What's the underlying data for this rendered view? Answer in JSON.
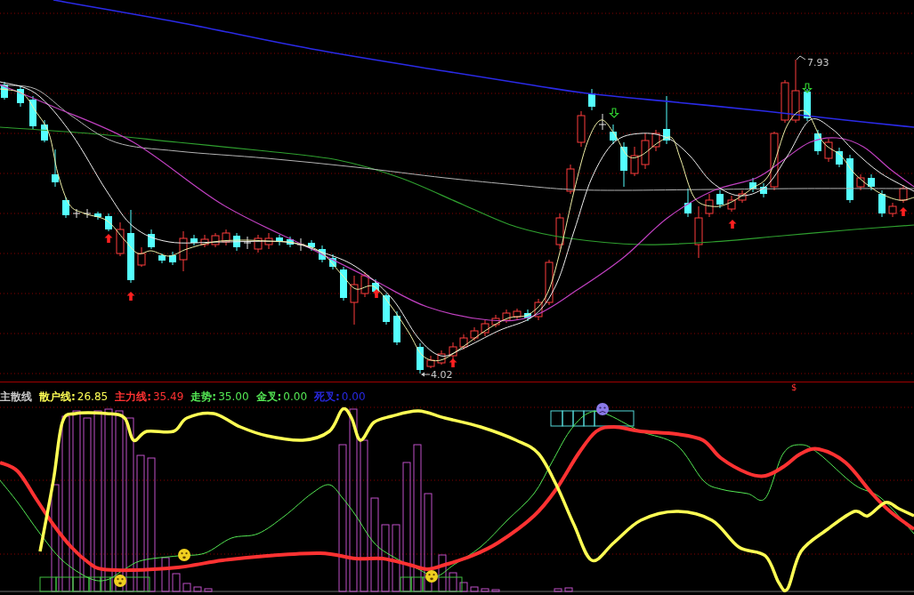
{
  "price_chart": {
    "high_label": "7.93",
    "low_label": "4.02",
    "signal_mark": "$"
  },
  "indicator_legend": [
    {
      "label": "主散线",
      "color": "#c8c8c8"
    },
    {
      "label": "散户线:",
      "value": "26.85",
      "color": "#ffff54"
    },
    {
      "label": "主力线:",
      "value": "35.49",
      "color": "#ff3232"
    },
    {
      "label": "走势:",
      "value": "35.00",
      "color": "#54e854"
    },
    {
      "label": "金叉:",
      "value": "0.00",
      "color": "#54e854"
    },
    {
      "label": "死叉:",
      "value": "0.00",
      "color": "#2828e0"
    }
  ]
}
